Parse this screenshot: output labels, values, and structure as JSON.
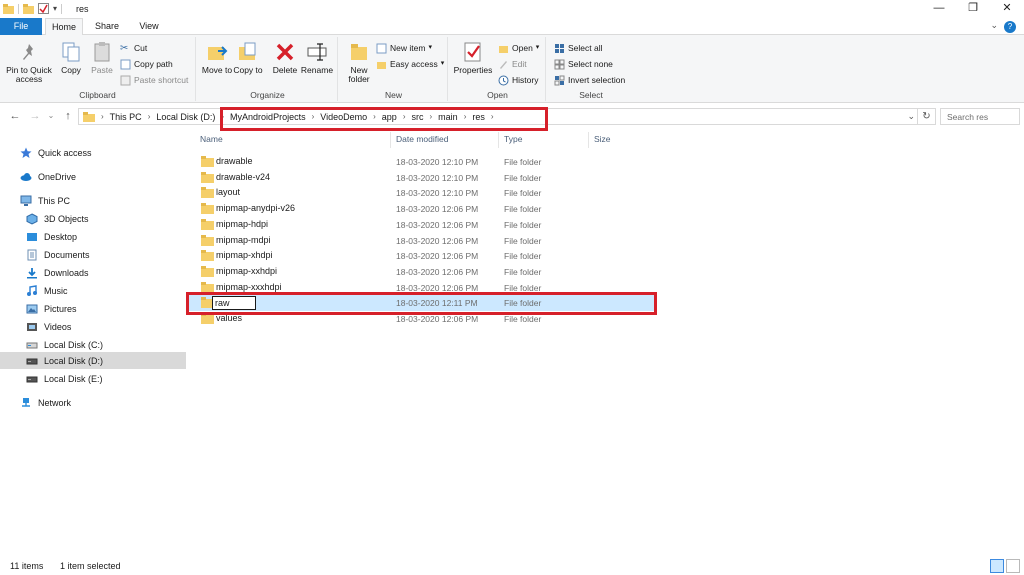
{
  "window": {
    "title": "res",
    "controls": [
      "—",
      "❐",
      "✕"
    ]
  },
  "tabs": {
    "file": "File",
    "home": "Home",
    "share": "Share",
    "view": "View"
  },
  "ribbon": {
    "clipboard": {
      "label": "Clipboard",
      "pin": "Pin to Quick access",
      "copy": "Copy",
      "paste": "Paste",
      "cut": "Cut",
      "copy_path": "Copy path",
      "paste_shortcut": "Paste shortcut"
    },
    "organize": {
      "label": "Organize",
      "move_to": "Move to",
      "copy_to": "Copy to",
      "delete": "Delete",
      "rename": "Rename"
    },
    "new": {
      "label": "New",
      "new_folder": "New folder",
      "new_item": "New item",
      "easy_access": "Easy access"
    },
    "open": {
      "label": "Open",
      "properties": "Properties",
      "open": "Open",
      "edit": "Edit",
      "history": "History"
    },
    "select": {
      "label": "Select",
      "select_all": "Select all",
      "select_none": "Select none",
      "invert": "Invert selection"
    }
  },
  "address": {
    "crumbs": [
      "This PC",
      "Local Disk (D:)",
      "MyAndroidProjects",
      "VideoDemo",
      "app",
      "src",
      "main",
      "res"
    ],
    "search_placeholder": "Search res"
  },
  "navpane": {
    "items": [
      {
        "label": "Quick access",
        "icon": "star-icon"
      },
      {
        "label": "OneDrive",
        "icon": "cloud-icon"
      },
      {
        "label": "This PC",
        "icon": "pc-icon"
      },
      {
        "label": "3D Objects",
        "icon": "cube-icon"
      },
      {
        "label": "Desktop",
        "icon": "desktop-icon"
      },
      {
        "label": "Documents",
        "icon": "documents-icon"
      },
      {
        "label": "Downloads",
        "icon": "download-icon"
      },
      {
        "label": "Music",
        "icon": "music-icon"
      },
      {
        "label": "Pictures",
        "icon": "pictures-icon"
      },
      {
        "label": "Videos",
        "icon": "videos-icon"
      },
      {
        "label": "Local Disk (C:)",
        "icon": "drive-icon"
      },
      {
        "label": "Local Disk (D:)",
        "icon": "drive-icon"
      },
      {
        "label": "Local Disk (E:)",
        "icon": "drive-icon"
      },
      {
        "label": "Network",
        "icon": "network-icon"
      }
    ]
  },
  "columns": {
    "name": "Name",
    "date": "Date modified",
    "type": "Type",
    "size": "Size"
  },
  "files": [
    {
      "name": "drawable",
      "date": "18-03-2020 12:10 PM",
      "type": "File folder"
    },
    {
      "name": "drawable-v24",
      "date": "18-03-2020 12:10 PM",
      "type": "File folder"
    },
    {
      "name": "layout",
      "date": "18-03-2020 12:10 PM",
      "type": "File folder"
    },
    {
      "name": "mipmap-anydpi-v26",
      "date": "18-03-2020 12:06 PM",
      "type": "File folder"
    },
    {
      "name": "mipmap-hdpi",
      "date": "18-03-2020 12:06 PM",
      "type": "File folder"
    },
    {
      "name": "mipmap-mdpi",
      "date": "18-03-2020 12:06 PM",
      "type": "File folder"
    },
    {
      "name": "mipmap-xhdpi",
      "date": "18-03-2020 12:06 PM",
      "type": "File folder"
    },
    {
      "name": "mipmap-xxhdpi",
      "date": "18-03-2020 12:06 PM",
      "type": "File folder"
    },
    {
      "name": "mipmap-xxxhdpi",
      "date": "18-03-2020 12:06 PM",
      "type": "File folder"
    },
    {
      "name": "raw",
      "date": "18-03-2020 12:11 PM",
      "type": "File folder"
    },
    {
      "name": "values",
      "date": "18-03-2020 12:06 PM",
      "type": "File folder"
    }
  ],
  "status": {
    "count": "11 items",
    "selected": "1 item selected"
  },
  "colors": {
    "accent": "#1979ca",
    "highlight": "#d6202a",
    "selection": "#cce8ff",
    "folder": "#f5cf6a"
  }
}
